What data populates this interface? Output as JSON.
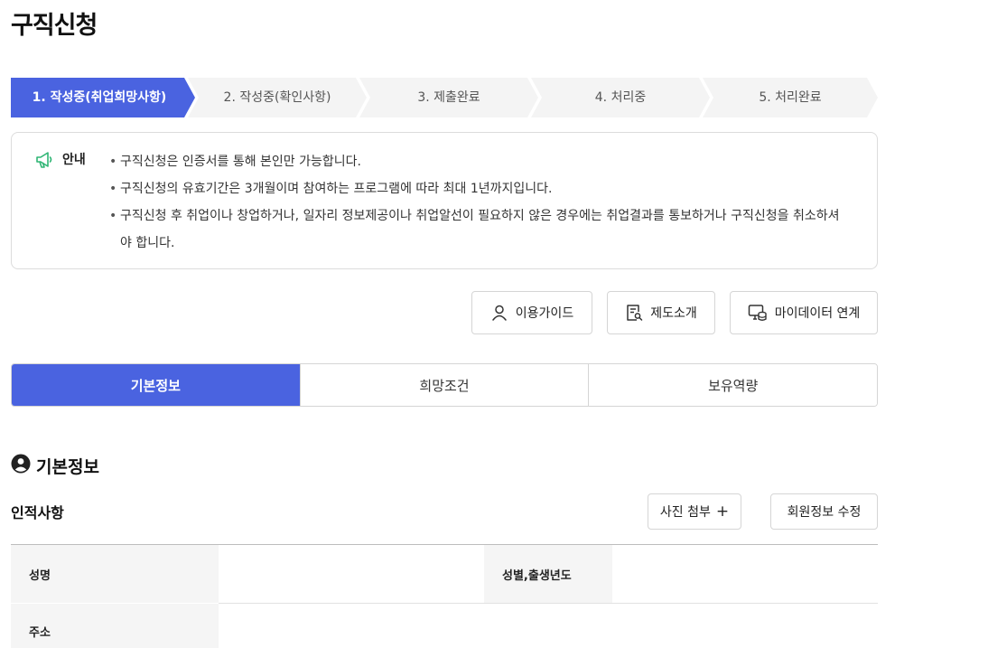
{
  "page": {
    "title": "구직신청"
  },
  "steps": [
    {
      "label": "1. 작성중(취업희망사항)",
      "active": true
    },
    {
      "label": "2. 작성중(확인사항)",
      "active": false
    },
    {
      "label": "3. 제출완료",
      "active": false
    },
    {
      "label": "4. 처리중",
      "active": false
    },
    {
      "label": "5. 처리완료",
      "active": false
    }
  ],
  "notice": {
    "title": "안내",
    "icon": "megaphone-icon",
    "items": [
      "구직신청은 인증서를 통해 본인만 가능합니다.",
      "구직신청의 유효기간은 3개월이며 참여하는 프로그램에 따라 최대 1년까지입니다.",
      "구직신청 후 취업이나 창업하거나, 일자리 정보제공이나 취업알선이 필요하지 않은 경우에는 취업결과를 통보하거나 구직신청을 취소하셔야 합니다."
    ]
  },
  "utility_buttons": {
    "guide": "이용가이드",
    "system_intro": "제도소개",
    "mydata": "마이데이터 연계"
  },
  "tabs": [
    {
      "label": "기본정보",
      "active": true
    },
    {
      "label": "희망조건",
      "active": false
    },
    {
      "label": "보유역량",
      "active": false
    }
  ],
  "section": {
    "title": "기본정보",
    "subtitle": "인적사항",
    "attach_photo": "사진 첨부",
    "attach_plus": "+",
    "edit_member": "회원정보 수정"
  },
  "table": {
    "name_label": "성명",
    "gender_birth_label": "성별,출생년도",
    "address_label": "주소"
  },
  "colors": {
    "accent": "#4a63e0",
    "notice_icon": "#2fb574"
  }
}
